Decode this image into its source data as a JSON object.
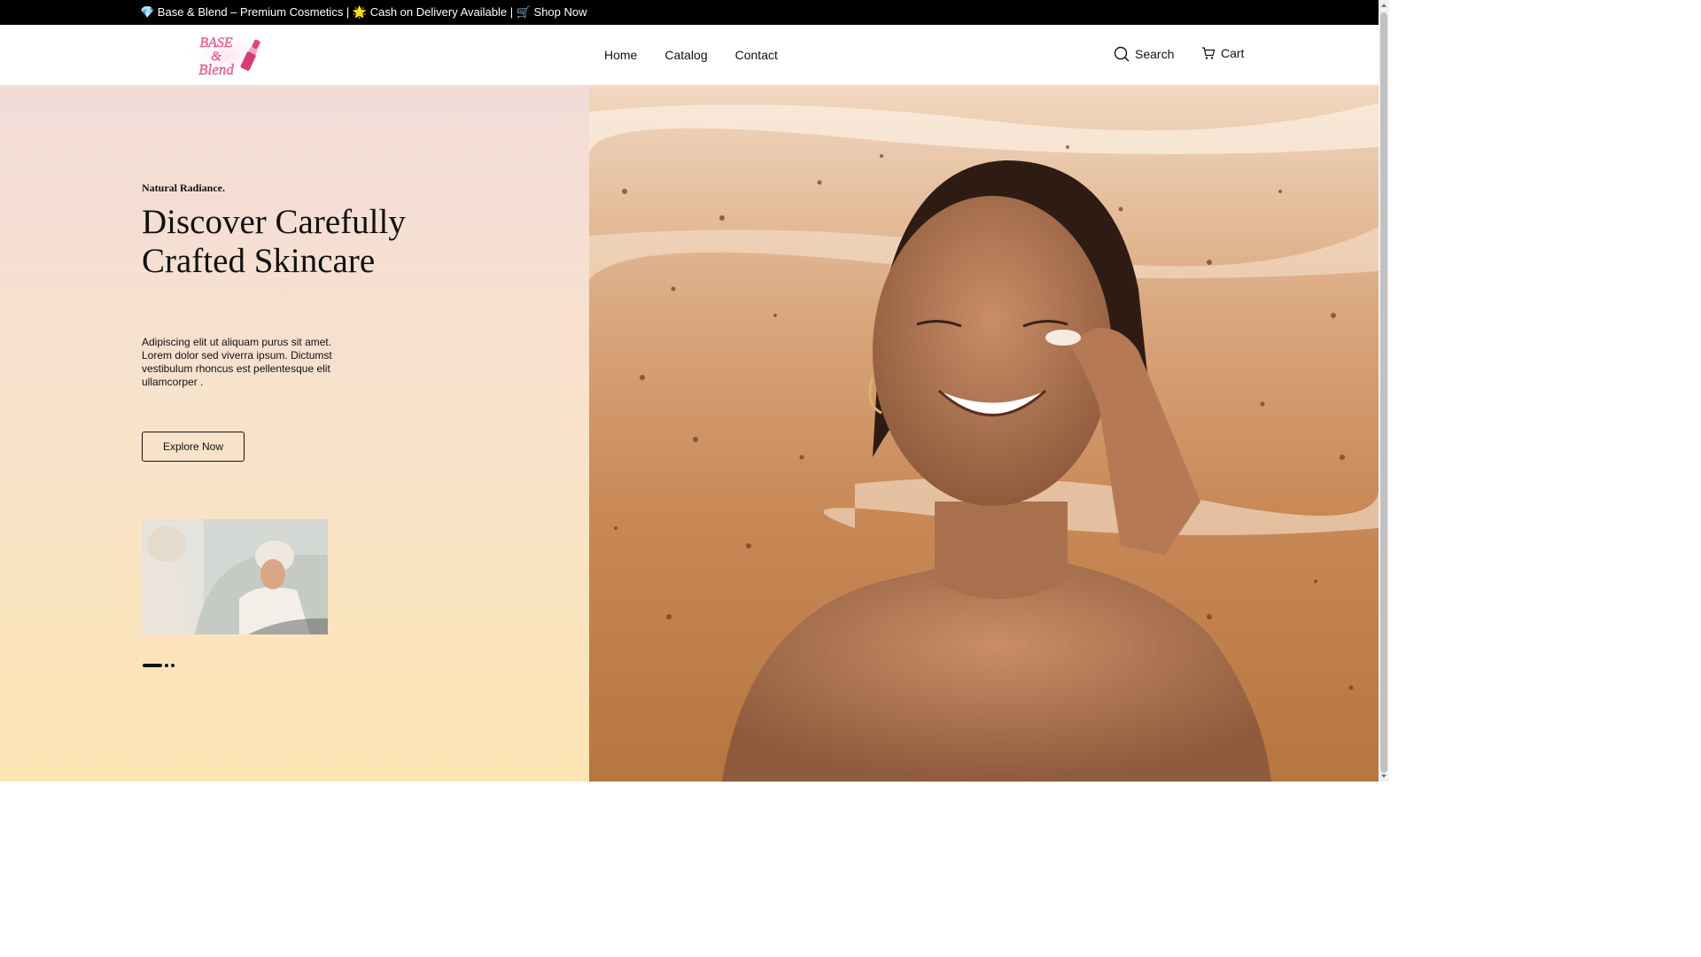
{
  "announcement": {
    "text": "💎 Base & Blend – Premium Cosmetics | 🌟 Cash on Delivery Available | 🛒 Shop Now"
  },
  "header": {
    "logo": {
      "line1": "BASE",
      "line2": "&",
      "line3": "Blend"
    },
    "nav": [
      "Home",
      "Catalog",
      "Contact"
    ],
    "search_label": "Search",
    "cart_label": "Cart"
  },
  "hero": {
    "eyebrow": "Natural Radiance.",
    "headline": "Discover Carefully Crafted Skincare",
    "body": "Adipiscing elit ut aliquam purus sit amet. Lorem dolor sed viverra ipsum. Dictumst vestibulum rhoncus est pellentesque elit ullamcorper .",
    "cta_label": "Explore Now"
  },
  "carousel": {
    "slides": 3,
    "active_index": 0
  },
  "colors": {
    "announcement_bg": "#000000",
    "hero_gradient_top": "#f2dcd8",
    "hero_gradient_bottom": "#fde5b4",
    "logo_pink": "#f27aa8"
  },
  "icons": {
    "search": "search-icon",
    "cart": "cart-icon"
  }
}
